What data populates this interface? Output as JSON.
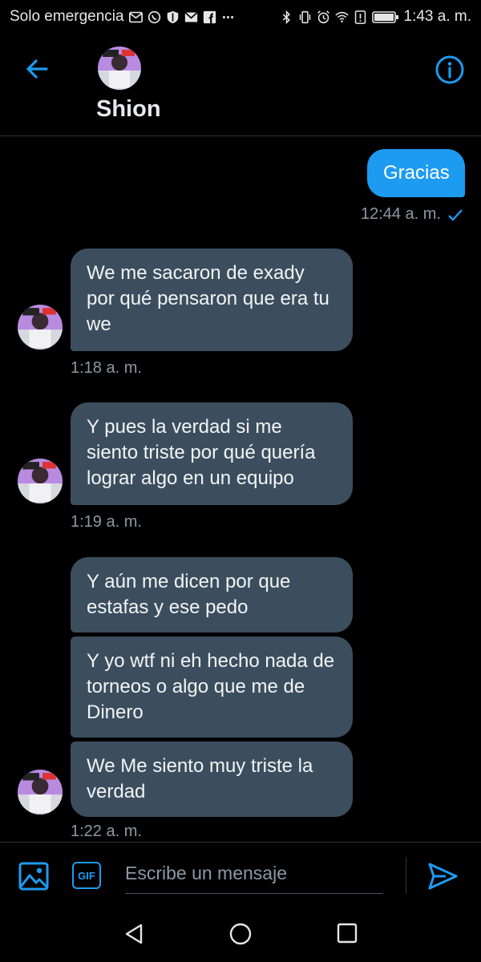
{
  "status_bar": {
    "carrier": "Solo emergencia",
    "time": "1:43 a. m.",
    "notification_icons": [
      "gmail-icon",
      "whatsapp-icon",
      "shield-icon",
      "mail-icon",
      "facebook-icon",
      "more-dots-icon"
    ],
    "system_icons": [
      "bluetooth-icon",
      "vibrate-icon",
      "alarm-icon",
      "wifi-icon",
      "alert-icon",
      "battery-icon"
    ]
  },
  "header": {
    "name": "Shion",
    "back_icon": "arrow-left-icon",
    "info_icon": "info-icon"
  },
  "messages": [
    {
      "direction": "out",
      "text": "Gracias",
      "time": "12:44 a. m.",
      "status_icon": "checkmark-icon"
    },
    {
      "direction": "in",
      "text": "We me sacaron de exady por qué pensaron que era tu we",
      "time": "1:18 a. m."
    },
    {
      "direction": "in",
      "text": "Y pues la verdad si me siento triste por qué quería lograr algo en un equipo",
      "time": "1:19 a. m."
    },
    {
      "direction": "in",
      "text": "Y aún me dicen por que estafas y ese pedo"
    },
    {
      "direction": "in",
      "text": "Y yo wtf ni eh hecho nada de torneos o algo que me de Dinero"
    },
    {
      "direction": "in",
      "text": "We Me siento muy triste la verdad",
      "time": "1:22 a. m."
    }
  ],
  "compose": {
    "placeholder": "Escribe un mensaje",
    "gif_label": "GIF",
    "media_icon": "image-icon",
    "send_icon": "send-icon"
  },
  "colors": {
    "accent": "#1d9bf0",
    "incoming_bubble": "#3c4e5e",
    "background": "#000000",
    "muted_text": "#8b98a5"
  }
}
